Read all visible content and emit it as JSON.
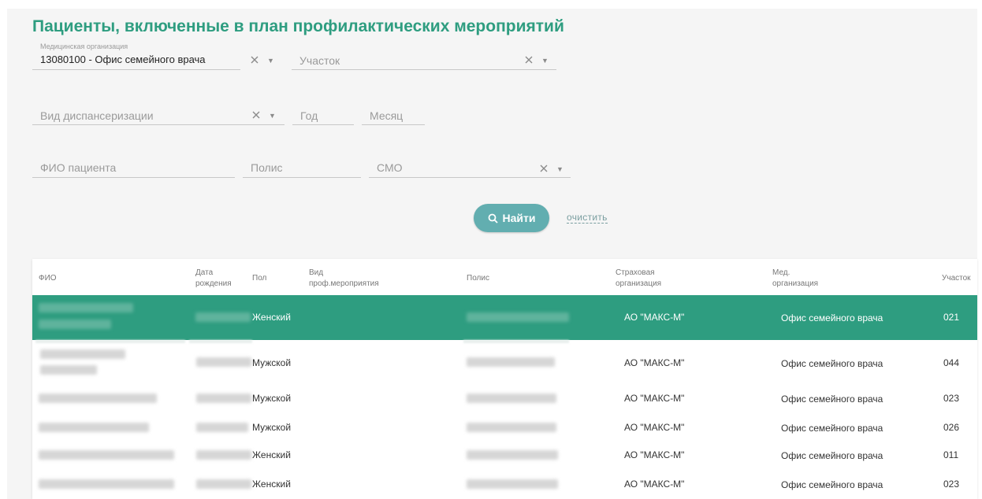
{
  "page": {
    "title": "Пациенты, включенные в план профилактических мероприятий"
  },
  "filters": {
    "med_org": {
      "label": "Медицинская организация",
      "value": "13080100 - Офис семейного врача"
    },
    "uchastok": {
      "placeholder": "Участок"
    },
    "vid_disp": {
      "placeholder": "Вид диспансеризации"
    },
    "year": {
      "placeholder": "Год"
    },
    "month": {
      "placeholder": "Месяц"
    },
    "fio": {
      "placeholder": "ФИО пациента"
    },
    "polis": {
      "placeholder": "Полис"
    },
    "smo": {
      "placeholder": "СМО"
    }
  },
  "actions": {
    "find_label": "Найти",
    "clear_label": "очистить"
  },
  "table": {
    "columns": [
      {
        "key": "fio",
        "label1": "ФИО",
        "label2": ""
      },
      {
        "key": "dob",
        "label1": "Дата",
        "label2": "рождения"
      },
      {
        "key": "sex",
        "label1": "Пол",
        "label2": ""
      },
      {
        "key": "vid",
        "label1": "Вид",
        "label2": "проф.мероприятия"
      },
      {
        "key": "polis",
        "label1": "Полис",
        "label2": ""
      },
      {
        "key": "insurer",
        "label1": "Страховая",
        "label2": "организация"
      },
      {
        "key": "medorg",
        "label1": "Мед.",
        "label2": "организация"
      },
      {
        "key": "uch",
        "label1": "Участок",
        "label2": ""
      }
    ],
    "rows": [
      {
        "sex": "Женский",
        "insurer": "АО \"МАКС-М\"",
        "medorg": "Офис семейного врача",
        "uch": "021",
        "selected": true
      },
      {
        "sex": "Мужской",
        "insurer": "АО \"МАКС-М\"",
        "medorg": "Офис семейного врача",
        "uch": "044",
        "selected": false
      },
      {
        "sex": "Мужской",
        "insurer": "АО \"МАКС-М\"",
        "medorg": "Офис семейного врача",
        "uch": "023",
        "selected": false
      },
      {
        "sex": "Мужской",
        "insurer": "АО \"МАКС-М\"",
        "medorg": "Офис семейного врача",
        "uch": "026",
        "selected": false
      },
      {
        "sex": "Женский",
        "insurer": "АО \"МАКС-М\"",
        "medorg": "Офис семейного врача",
        "uch": "011",
        "selected": false
      },
      {
        "sex": "Женский",
        "insurer": "АО \"МАКС-М\"",
        "medorg": "Офис семейного врача",
        "uch": "023",
        "selected": false
      }
    ]
  },
  "colors": {
    "accent": "#2e9d80",
    "button": "#62aeb0",
    "link": "#7a9ea0"
  },
  "icons": {
    "search": "search-icon",
    "clear": "close-icon",
    "dropdown": "chevron-down-icon"
  }
}
